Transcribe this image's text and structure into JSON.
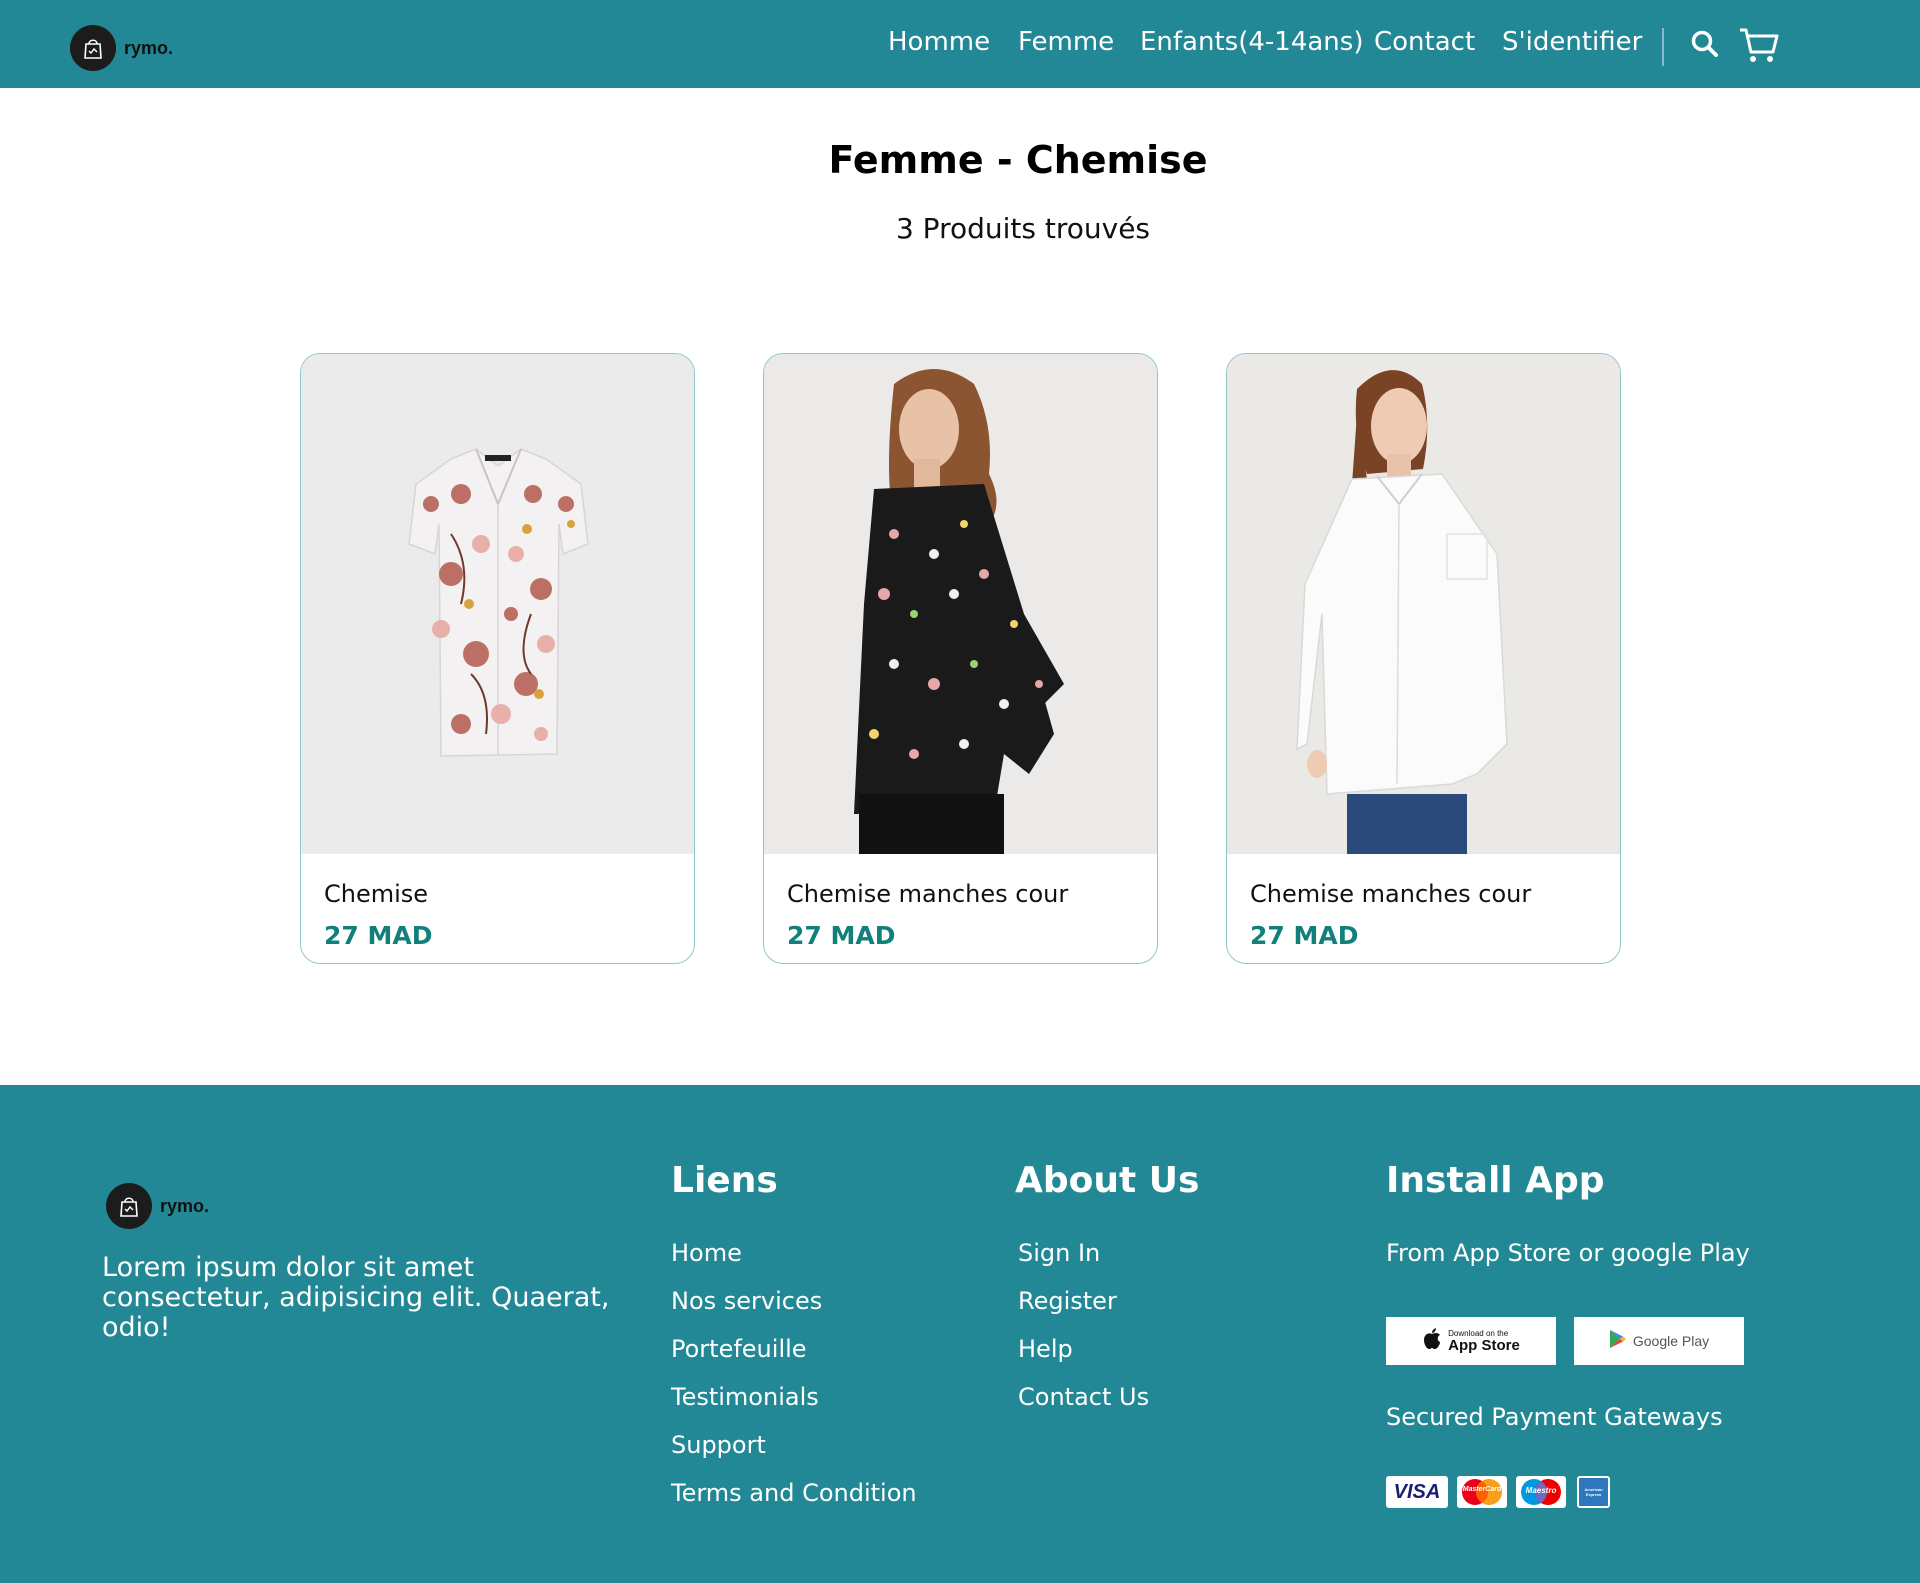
{
  "colors": {
    "primary": "#228895",
    "price": "#11807a",
    "card_border": "#8fc7c9"
  },
  "header": {
    "brand": "rymo.",
    "nav": [
      "Homme",
      "Femme",
      "Enfants(4-14ans)",
      "Contact",
      "S'identifier"
    ],
    "icons": [
      "search-icon",
      "cart-icon"
    ]
  },
  "main": {
    "title": "Femme - Chemise",
    "result_count": "3 Produits trouvés",
    "products": [
      {
        "name": "Chemise",
        "price": "27 MAD"
      },
      {
        "name": "Chemise manches cour",
        "price": "27 MAD"
      },
      {
        "name": "Chemise manches cour",
        "price": "27 MAD"
      }
    ]
  },
  "footer": {
    "brand": "rymo.",
    "description": "Lorem ipsum dolor sit amet consectetur, adipisicing elit. Quaerat, odio!",
    "links": {
      "title": "Liens",
      "items": [
        "Home",
        "Nos services",
        "Portefeuille",
        "Testimonials",
        "Support",
        "Terms and Condition"
      ]
    },
    "about": {
      "title": "About Us",
      "items": [
        "Sign In",
        "Register",
        "Help",
        "Contact Us"
      ]
    },
    "app": {
      "title": "Install App",
      "subtitle": "From App Store or google Play",
      "app_store_small": "Download on the",
      "app_store": "App Store",
      "google_play": "Google Play",
      "payment_title": "Secured Payment Gateways",
      "payments": [
        "VISA",
        "MasterCard",
        "Maestro",
        "American Express"
      ]
    }
  }
}
